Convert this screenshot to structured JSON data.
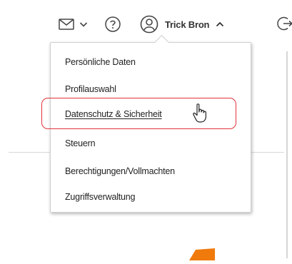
{
  "header": {
    "user_name": "Trick Bron",
    "icons": [
      "mail-icon",
      "chevron-down-icon",
      "help-icon",
      "user-avatar-icon",
      "chevron-up-icon",
      "logout-icon"
    ]
  },
  "menu": {
    "items": [
      {
        "label": "Persönliche Daten"
      },
      {
        "label": "Profilauswahl"
      },
      {
        "label": "Datenschutz & Sicherheit",
        "highlighted": true
      },
      {
        "label": "Steuern"
      },
      {
        "label": "Berechtigungen/Vollmachten"
      },
      {
        "label": "Zugriffsverwaltung"
      }
    ]
  },
  "colors": {
    "highlight_border": "#e0343b",
    "accent": "#f07a0c",
    "text": "#222222"
  }
}
